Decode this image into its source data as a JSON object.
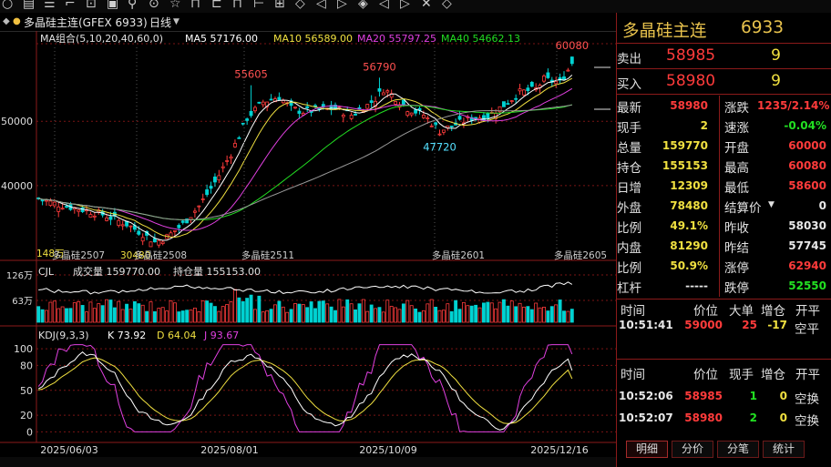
{
  "toolbar": {
    "icons": [
      "circle-icon",
      "print-icon",
      "menu-icon",
      "chart-icon",
      "layout-icon",
      "tool-icon",
      "star-icon",
      "window-icon",
      "tile-icon",
      "grid-icon",
      "flag-icon",
      "refresh-icon",
      "list-icon",
      "book-icon",
      "back-icon",
      "forward-icon",
      "tag-icon",
      "arrow-left-icon",
      "arrow-right-icon",
      "close-icon",
      "diamond-icon",
      "more-icon"
    ]
  },
  "title": {
    "instrument": "多晶硅主连(GFEX 6933)",
    "period": "日线"
  },
  "legend": {
    "ma": {
      "group": "MA组合(5,10,20,40,60,0)",
      "ma5": "MA5 57176.00",
      "ma10": "MA10 56589.00",
      "ma20": "MA20 55797.25",
      "ma40": "MA40 54662.13"
    },
    "vol": {
      "name": "CJL",
      "volume": "成交量 159770.00",
      "oi": "持仓量 155153.00"
    },
    "kdj": {
      "name": "KDJ(9,3,3)",
      "k": "K 73.92",
      "d": "D 64.04",
      "j": "J 93.67"
    }
  },
  "colors": {
    "up": "#ff3b3b",
    "down": "#00d2d2",
    "ma5": "#ffffff",
    "ma10": "#f0e040",
    "ma20": "#e040e0",
    "ma40": "#22dd22",
    "ma60": "#9a9a9a",
    "kdj_k": "#ffffff",
    "kdj_d": "#f0e040",
    "kdj_j": "#e040e0",
    "grid": "#7a1414"
  },
  "price_axis": {
    "labels": [
      "50000",
      "40000"
    ]
  },
  "vol_axis": {
    "labels": [
      "126万",
      "63万"
    ]
  },
  "kdj_axis": {
    "labels": [
      "100",
      "80",
      "50",
      "20",
      "0"
    ]
  },
  "annotations": {
    "high_a": "55605",
    "high_b": "56790",
    "high_c": "60080",
    "low_a": "47720",
    "low_marker": "148万",
    "low_label": "30480"
  },
  "contract_labels": [
    "多晶硅2507",
    "多晶硅2508",
    "多晶硅2511",
    "多晶硅2601",
    "多晶硅2605"
  ],
  "dates": [
    "2025/06/03",
    "2025/08/01",
    "2025/10/09",
    "2025/12/16"
  ],
  "quote": {
    "name": "多晶硅主连",
    "code": "6933",
    "sell_label": "卖出",
    "sell_price": "58985",
    "sell_qty": "9",
    "buy_label": "买入",
    "buy_price": "58980",
    "buy_qty": "9",
    "rows": [
      {
        "l1": "最新",
        "v1": "58980",
        "c1": "red",
        "l2": "涨跌",
        "v2": "1235/2.14%",
        "c2": "red"
      },
      {
        "l1": "现手",
        "v1": "2",
        "c1": "yel",
        "l2": "速涨",
        "v2": "-0.04%",
        "c2": "grn"
      },
      {
        "l1": "总量",
        "v1": "159770",
        "c1": "yel",
        "l2": "开盘",
        "v2": "60000",
        "c2": "red"
      },
      {
        "l1": "持仓",
        "v1": "155153",
        "c1": "yel",
        "l2": "最高",
        "v2": "60080",
        "c2": "red"
      },
      {
        "l1": "日增",
        "v1": "12309",
        "c1": "yel",
        "l2": "最低",
        "v2": "58600",
        "c2": "red"
      },
      {
        "l1": "外盘",
        "v1": "78480",
        "c1": "yel",
        "l2": "结算价",
        "v2": "0",
        "c2": "wht"
      },
      {
        "l1": "比例",
        "v1": "49.1%",
        "c1": "yel",
        "l2": "昨收",
        "v2": "58030",
        "c2": "wht"
      },
      {
        "l1": "内盘",
        "v1": "81290",
        "c1": "yel",
        "l2": "昨结",
        "v2": "57745",
        "c2": "wht"
      },
      {
        "l1": "比例",
        "v1": "50.9%",
        "c1": "yel",
        "l2": "涨停",
        "v2": "62940",
        "c2": "red"
      },
      {
        "l1": "杠杆",
        "v1": "-----",
        "c1": "wht",
        "l2": "跌停",
        "v2": "52550",
        "c2": "grn"
      }
    ],
    "big_header": {
      "time": "时间",
      "price": "价位",
      "big": "大单",
      "inc": "增仓",
      "open": "开平"
    },
    "big_row": {
      "time": "10:51:41",
      "price": "59000",
      "big": "25",
      "inc": "-17",
      "open": "空平"
    },
    "tick_header": {
      "time": "时间",
      "price": "价位",
      "hand": "现手",
      "inc": "增仓",
      "open": "开平"
    },
    "ticks": [
      {
        "time": "10:52:06",
        "price": "58985",
        "hand": "1",
        "inc": "0",
        "open": "空换"
      },
      {
        "time": "10:52:07",
        "price": "58980",
        "hand": "2",
        "inc": "0",
        "open": "空换"
      }
    ],
    "tabs": [
      "明细",
      "分价",
      "分笔",
      "统计"
    ]
  },
  "chart_data": {
    "type": "candlestick",
    "y_ticks": [
      50000,
      40000
    ],
    "ylim": [
      29500,
      61500
    ],
    "n": 134,
    "anchors": [
      [
        0,
        38000
      ],
      [
        4,
        37200
      ],
      [
        10,
        36400
      ],
      [
        16,
        35500
      ],
      [
        22,
        34000
      ],
      [
        26,
        32500
      ],
      [
        29,
        31200
      ],
      [
        32,
        32000
      ],
      [
        36,
        34000
      ],
      [
        40,
        36800
      ],
      [
        44,
        40500
      ],
      [
        48,
        45000
      ],
      [
        52,
        50500
      ],
      [
        56,
        53000
      ],
      [
        60,
        53800
      ],
      [
        63,
        52000
      ],
      [
        66,
        51500
      ],
      [
        70,
        51800
      ],
      [
        74,
        52000
      ],
      [
        78,
        51000
      ],
      [
        82,
        52500
      ],
      [
        84,
        53500
      ],
      [
        86,
        55000
      ],
      [
        88,
        54200
      ],
      [
        92,
        52000
      ],
      [
        96,
        51000
      ],
      [
        100,
        48500
      ],
      [
        104,
        49500
      ],
      [
        108,
        50500
      ],
      [
        112,
        50800
      ],
      [
        116,
        52500
      ],
      [
        120,
        54500
      ],
      [
        124,
        55000
      ],
      [
        126,
        56500
      ],
      [
        130,
        56000
      ],
      [
        133,
        58980
      ]
    ],
    "marks": [
      {
        "label": "55605",
        "idx": 53,
        "price": 55605
      },
      {
        "label": "56790",
        "idx": 85,
        "price": 56790
      },
      {
        "label": "47720",
        "idx": 100,
        "price": 47720
      },
      {
        "label": "60080",
        "idx": 133,
        "price": 60080
      }
    ],
    "vol_ylim": [
      0,
      1500000
    ],
    "kdj_ylim": [
      -5,
      110
    ]
  }
}
